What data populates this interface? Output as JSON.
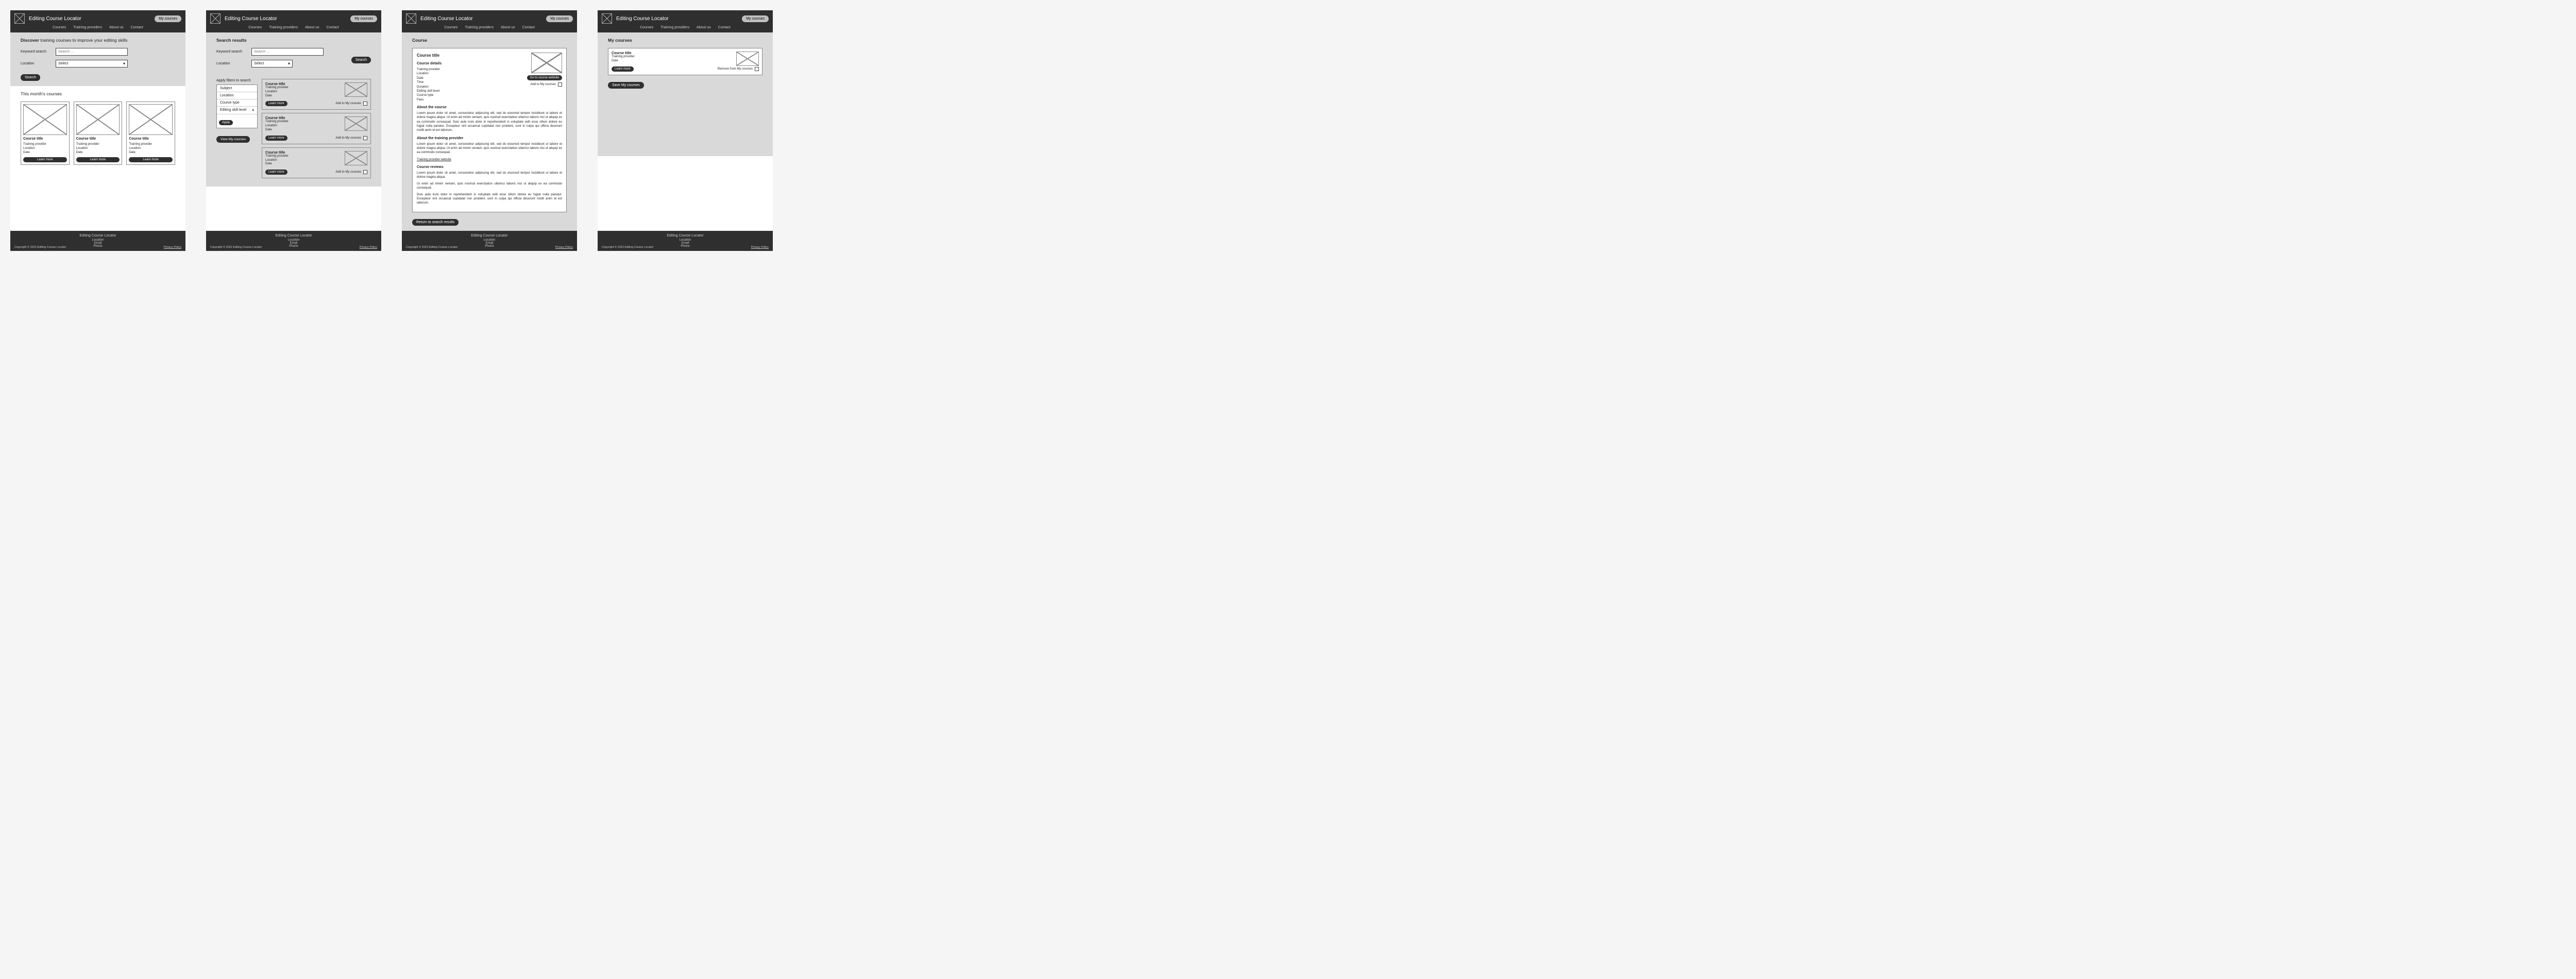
{
  "common": {
    "site_title": "Editing Course Locator",
    "nav": [
      "Courses",
      "Training providers",
      "About us",
      "Contact"
    ],
    "header_btn": "My courses",
    "footer": {
      "title": "Editing Course Locator",
      "lines": [
        "Location",
        "Email",
        "Phone"
      ],
      "copyright": "Copyright © 2022 Editing Course Locator",
      "privacy": "Privacy Policy"
    },
    "search_placeholder": "Search …",
    "select_placeholder": "Select",
    "keyword_label": "Keyword search",
    "location_label": "Location",
    "search_btn": "Search",
    "learn_more": "Learn more",
    "add_to_my": "Add to My courses",
    "remove_from_my": "Remove from My courses",
    "card_meta": {
      "title": "Course title",
      "provider": "Training provider",
      "location": "Location",
      "date": "Date"
    }
  },
  "s1": {
    "headline_bold": "Discover",
    "headline_rest": " training courses to improve your editing skills",
    "section2_title": "This month's courses"
  },
  "s2": {
    "results_title": "Search results",
    "filters_title": "Apply filters to search",
    "filters": [
      "Subject",
      "Location",
      "Course type",
      "Editing skill level"
    ],
    "apply": "Apply",
    "view_my": "View My courses"
  },
  "s3": {
    "page_title": "Course",
    "card_title": "Course title",
    "details_h": "Course details",
    "details": [
      "Training provider",
      "Location",
      "Date",
      "Time",
      "Duration",
      "Editing skill level",
      "Course type",
      "Fees"
    ],
    "go_to_site": "Go to course website",
    "about_course_h": "About the course",
    "about_course_p1": "Lorem ipsum dolor sit amet, consectetur adipiscing elit, sed do eiusmod tempor incididunt ut labore et dolore magna aliqua. Ut enim ad minim veniam, quis nostrud exercitation ullamco laboris nisi ut aliquip ex ea commodo consequat. Duis aute irure dolor in reprehenderit in voluptate velit esse cillum dolore eu fugiat nulla pariatur. Excepteur sint occaecat cupidatat non proident, sunt in culpa qui officia deserunt mollit anim id est laborum.",
    "about_provider_h": "About the training provider",
    "about_provider_p": "Lorem ipsum dolor sit amet, consectetur adipiscing elit, sed do eiusmod tempor incididunt ut labore et dolore magna aliqua. Ut enim ad minim veniam, quis nostrud exercitation ullamco laboris nisi ut aliquip ex ea commodo consequat.",
    "provider_link": "Training provider website",
    "reviews_h": "Course reviews",
    "review1": "Lorem ipsum dolor sit amet, consectetur adipiscing elit, sed do eiusmod tempor incididunt ut labore et dolore magna aliqua.",
    "review2": "Ut enim ad minim veniam, quis nostrud exercitation ullamco laboris nisi ut aliquip ex ea commodo consequat.",
    "review3": "Duis aute irure dolor in reprehenderit in voluptate velit esse cillum dolore eu fugiat nulla pariatur. Excepteur sint occaecat cupidatat non proident, sunt in culpa qui officia deserunt mollit anim id est laborum.",
    "return_btn": "Return to search results"
  },
  "s4": {
    "page_title": "My courses",
    "save_btn": "Save My courses"
  }
}
